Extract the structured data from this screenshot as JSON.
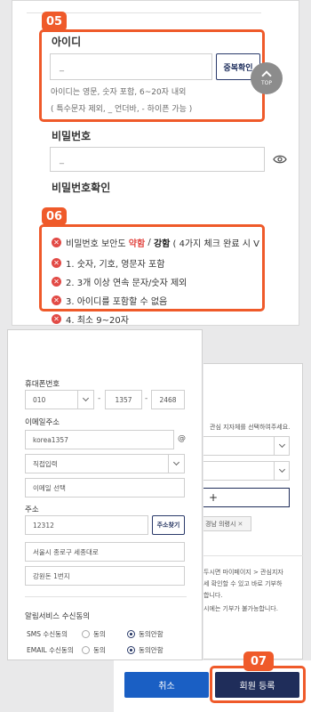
{
  "badges": {
    "b05": "05",
    "b06": "06",
    "b07": "07"
  },
  "top": {
    "id_label": "아이디",
    "id_value": "_",
    "dup_button": "중복확인",
    "id_help_1": "아이디는 영문, 숫자 포함, 6~20자 내외",
    "id_help_2": "( 특수문자 제외, _ 언더바, - 하이픈 가능 )",
    "pw_label": "비밀번호",
    "pw_value": "_",
    "pw_confirm_label": "비밀번호확인",
    "scroll_top": "TOP"
  },
  "rules": {
    "strength_prefix": "비밀번호 보안도",
    "weak": "약함",
    "sep": "/",
    "strong": "강함",
    "strength_suffix": "( 4가지 체크 완료 시 V",
    "r1": "1. 숫자, 기호, 영문자 포함",
    "r2": "2. 3개 이상 연속 문자/숫자 제외",
    "r3": "3. 아이디를 포함할 수 없음",
    "r4": "4. 최소 9~20자"
  },
  "form": {
    "phone_label": "휴대폰번호",
    "phone_1": "010",
    "phone_2": "1357",
    "phone_3": "2468",
    "dash": "-",
    "email_label": "이메일주소",
    "email_id": "korea1357",
    "at": "@",
    "email_domain": "직접입력",
    "email_select": "이메일 선택",
    "address_label": "주소",
    "zip": "12312",
    "addr_button": "주소찾기",
    "addr_1": "서울시 종로구 세종대로",
    "addr_2": "강원돈 1번지",
    "notice_label": "알림서비스 수신동의",
    "sms_label": "SMS 수신동의",
    "email_consent_label": "EMAIL 수신동의",
    "agree": "동의",
    "disagree": "동의안함"
  },
  "right": {
    "region_hint": "관심 지자체를 선택하여주세요.",
    "plus": "+",
    "tag": "경남 의령시",
    "note_1": "두시면 마이페이지 > 관심지자",
    "note_2": "세 확인할 수 있고 바로 기부하",
    "note_3": "합니다.",
    "note_4": "시에는 기부가 불가능합니다."
  },
  "footer": {
    "cancel": "취소",
    "signup": "회원 등록"
  }
}
